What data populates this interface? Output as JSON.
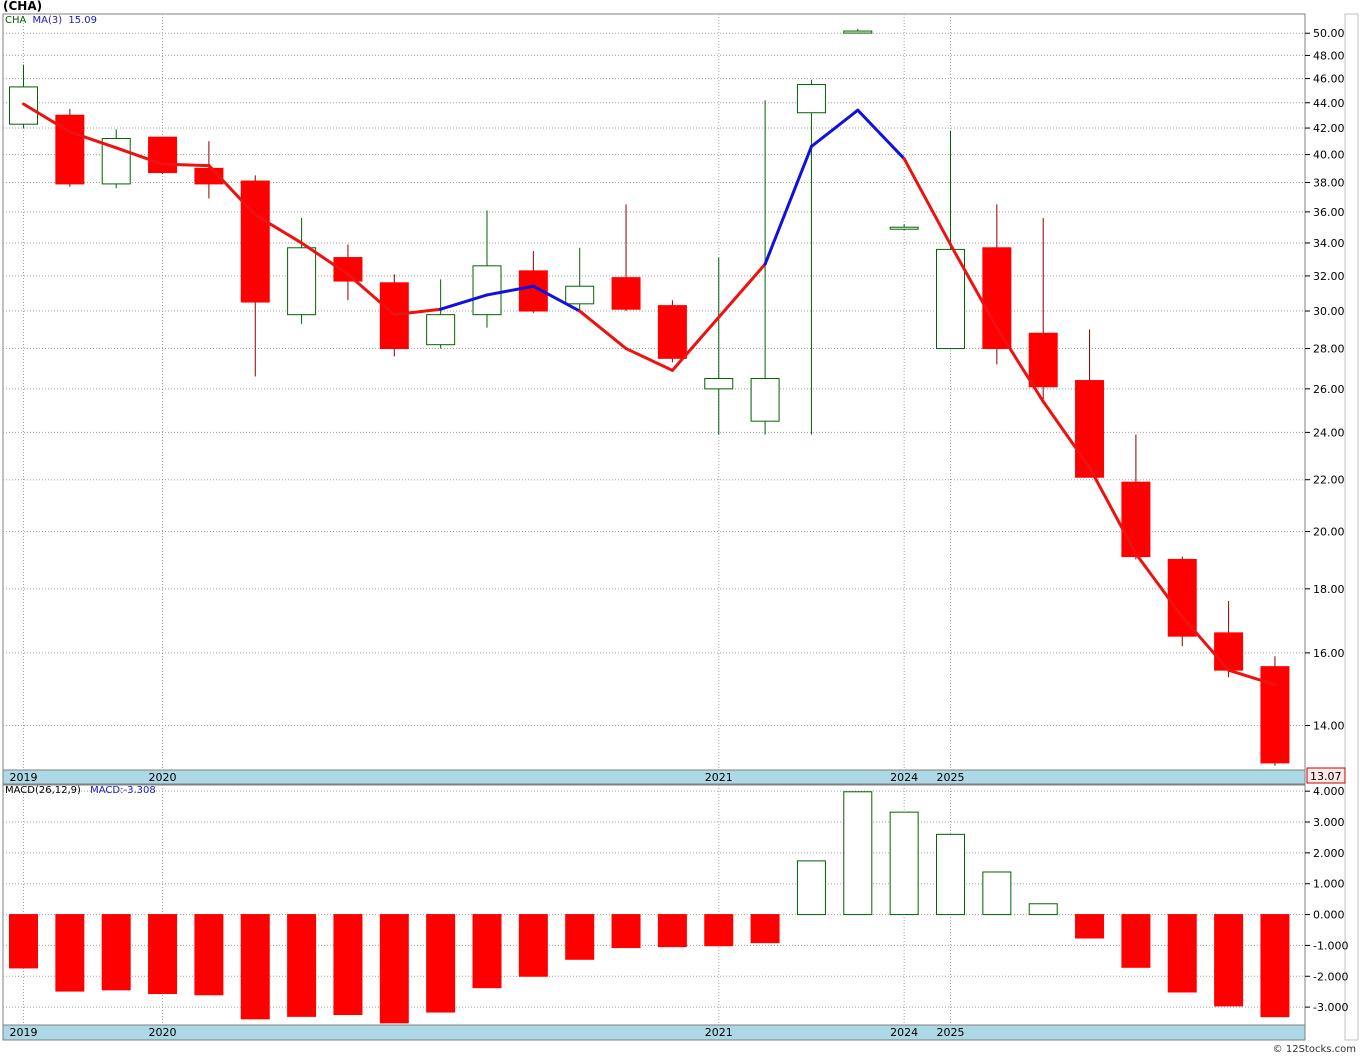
{
  "header": {
    "symbol": "(CHA)"
  },
  "legend": {
    "series1": "CHA",
    "ma_label": "MA(3)",
    "ma_value": "15.09",
    "macd_params": "MACD(26,12,9)",
    "macd_value": "MACD:-3.308"
  },
  "last_price_tag": "13.07",
  "credit": "© 12Stocks.com",
  "colors": {
    "down": "#ff0000",
    "up": "#ffffff",
    "up_border": "#006400",
    "ma_down": "#ee1111",
    "ma_up": "#1111dd",
    "axis_band": "#add8e6",
    "grid": "#a0a0a0"
  },
  "chart_data": [
    {
      "type": "candlestick",
      "title": "(CHA)",
      "y_scale": "log",
      "ylim": [
        12.9,
        51.8
      ],
      "y_ticks": [
        14,
        16,
        18,
        20,
        22,
        24,
        26,
        28,
        30,
        32,
        34,
        36,
        38,
        40,
        42,
        44,
        46,
        48,
        50
      ],
      "y_tick_labels": [
        "14.00",
        "16.00",
        "18.00",
        "20.00",
        "22.00",
        "24.00",
        "26.00",
        "28.00",
        "30.00",
        "32.00",
        "34.00",
        "36.00",
        "38.00",
        "40.00",
        "42.00",
        "44.00",
        "46.00",
        "48.00",
        "50.00"
      ],
      "x_labels": [
        {
          "label": "2019",
          "index": 0
        },
        {
          "label": "2020",
          "index": 3
        },
        {
          "label": "2021",
          "index": 15
        },
        {
          "label": "2024",
          "index": 19
        },
        {
          "label": "2025",
          "index": 20
        }
      ],
      "candles": [
        {
          "open": 42.3,
          "high": 47.2,
          "low": 42.0,
          "close": 45.3
        },
        {
          "open": 43.0,
          "high": 43.5,
          "low": 37.7,
          "close": 37.9
        },
        {
          "open": 37.9,
          "high": 41.9,
          "low": 37.6,
          "close": 41.2
        },
        {
          "open": 41.3,
          "high": 41.3,
          "low": 38.6,
          "close": 38.7
        },
        {
          "open": 39.0,
          "high": 41.0,
          "low": 36.9,
          "close": 37.9
        },
        {
          "open": 38.1,
          "high": 38.5,
          "low": 26.6,
          "close": 30.5
        },
        {
          "open": 29.8,
          "high": 35.6,
          "low": 29.3,
          "close": 33.7
        },
        {
          "open": 33.1,
          "high": 33.9,
          "low": 30.6,
          "close": 31.7
        },
        {
          "open": 31.6,
          "high": 32.1,
          "low": 27.6,
          "close": 28.0
        },
        {
          "open": 28.2,
          "high": 31.8,
          "low": 28.0,
          "close": 29.8
        },
        {
          "open": 29.8,
          "high": 36.1,
          "low": 29.1,
          "close": 32.6
        },
        {
          "open": 32.3,
          "high": 33.5,
          "low": 29.9,
          "close": 30.0
        },
        {
          "open": 30.4,
          "high": 33.7,
          "low": 30.0,
          "close": 31.4
        },
        {
          "open": 31.9,
          "high": 36.5,
          "low": 30.0,
          "close": 30.1
        },
        {
          "open": 30.3,
          "high": 30.6,
          "low": 27.3,
          "close": 27.5
        },
        {
          "open": 26.0,
          "high": 33.1,
          "low": 23.9,
          "close": 26.5
        },
        {
          "open": 24.5,
          "high": 44.2,
          "low": 23.9,
          "close": 26.5
        },
        {
          "open": 43.2,
          "high": 45.9,
          "low": 23.9,
          "close": 45.5
        },
        {
          "open": 50.1,
          "high": 50.4,
          "low": 50.0,
          "close": 50.2
        },
        {
          "open": 35.0,
          "high": 35.2,
          "low": 34.8,
          "close": 35.0
        },
        {
          "open": 28.0,
          "high": 41.8,
          "low": 28.0,
          "close": 33.6
        },
        {
          "open": 33.7,
          "high": 36.5,
          "low": 27.2,
          "close": 28.0
        },
        {
          "open": 28.8,
          "high": 35.6,
          "low": 25.3,
          "close": 26.1
        },
        {
          "open": 26.4,
          "high": 29.0,
          "low": 22.1,
          "close": 22.1
        },
        {
          "open": 21.9,
          "high": 23.9,
          "low": 19.0,
          "close": 19.1
        },
        {
          "open": 19.0,
          "high": 19.1,
          "low": 16.2,
          "close": 16.5
        },
        {
          "open": 16.6,
          "high": 17.6,
          "low": 15.3,
          "close": 15.5
        },
        {
          "open": 15.6,
          "high": 15.9,
          "low": 13.0,
          "close": 13.07
        }
      ],
      "ma_index": [
        0,
        1,
        2,
        3,
        4,
        5,
        6,
        7,
        8,
        9,
        10,
        11,
        12,
        13,
        14,
        16,
        17,
        18,
        19,
        20,
        21,
        22,
        23,
        24,
        25,
        26,
        27
      ],
      "ma_values": [
        43.9,
        41.7,
        40.5,
        39.3,
        39.2,
        35.8,
        34.0,
        32.1,
        29.8,
        30.1,
        30.9,
        31.4,
        30.0,
        28.0,
        26.9,
        32.7,
        40.6,
        43.4,
        39.7,
        33.9,
        29.1,
        25.4,
        22.5,
        19.2,
        17.1,
        15.5,
        15.09
      ],
      "ma_up_segments": [
        [
          9,
          12
        ],
        [
          16,
          19
        ]
      ]
    },
    {
      "type": "bar",
      "title": "MACD(26,12,9)",
      "ylim": [
        -3.58,
        4.2
      ],
      "y_ticks": [
        -3,
        -2,
        -1,
        0,
        1,
        2,
        3,
        4
      ],
      "y_tick_labels": [
        "-3.000",
        "-2.000",
        "-1.000",
        "0.000",
        "1.000",
        "2.000",
        "3.000",
        "4.000"
      ],
      "values": [
        -1.73,
        -2.48,
        -2.44,
        -2.56,
        -2.6,
        -3.38,
        -3.3,
        -3.24,
        -3.51,
        -3.16,
        -2.37,
        -2.0,
        -1.45,
        -1.07,
        -1.04,
        -1.01,
        -0.91,
        1.74,
        3.98,
        3.32,
        2.6,
        1.38,
        0.35,
        -0.76,
        -1.71,
        -2.51,
        -2.96,
        -3.31
      ]
    }
  ]
}
